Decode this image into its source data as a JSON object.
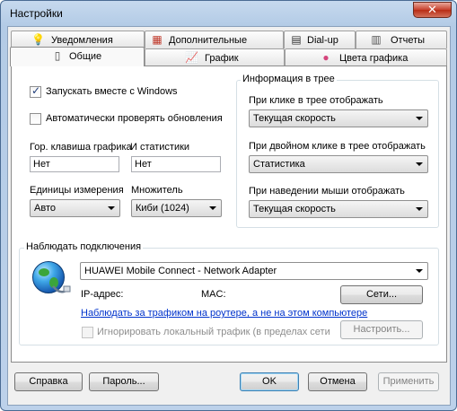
{
  "window": {
    "title": "Настройки"
  },
  "tabs": [
    {
      "label": "Уведомления",
      "icon": "lightbulb-icon"
    },
    {
      "label": "Дополнительные",
      "icon": "calendar-icon"
    },
    {
      "label": "Dial-up",
      "icon": "modem-icon"
    },
    {
      "label": "Отчеты",
      "icon": "report-icon"
    },
    {
      "label": "Общие",
      "icon": "general-icon",
      "active": true
    },
    {
      "label": "График",
      "icon": "chart-icon"
    },
    {
      "label": "Цвета графика",
      "icon": "palette-icon"
    }
  ],
  "general": {
    "autostart_label": "Запускать вместе с Windows",
    "autostart_checked": true,
    "check_updates_label": "Автоматически проверять обновления",
    "check_updates_checked": false,
    "hotkey_graph_label": "Гор. клавиша графика",
    "hotkey_graph_value": "Нет",
    "hotkey_stats_label": "И статистики",
    "hotkey_stats_value": "Нет",
    "units_label": "Единицы измерения",
    "units_value": "Авто",
    "multiplier_label": "Множитель",
    "multiplier_value": "Киби (1024)"
  },
  "tray": {
    "group_title": "Информация в трее",
    "click_label": "При клике в трее отображать",
    "click_value": "Текущая скорость",
    "dblclick_label": "При двойном клике в трее отображать",
    "dblclick_value": "Статистика",
    "hover_label": "При наведении мыши отображать",
    "hover_value": "Текущая скорость"
  },
  "connection": {
    "group_title": "Наблюдать подключения",
    "adapter_value": "HUAWEI Mobile Connect - Network Adapter",
    "ip_label": "IP-адрес:",
    "mac_label": "MAC:",
    "networks_button": "Сети...",
    "router_link": "Наблюдать за трафиком на роутере, а не на этом компьютере",
    "ignore_local_label": "Игнорировать локальный трафик (в пределах сети",
    "configure_button": "Настроить..."
  },
  "footer": {
    "help": "Справка",
    "password": "Пароль...",
    "ok": "OK",
    "cancel": "Отмена",
    "apply": "Применить"
  }
}
